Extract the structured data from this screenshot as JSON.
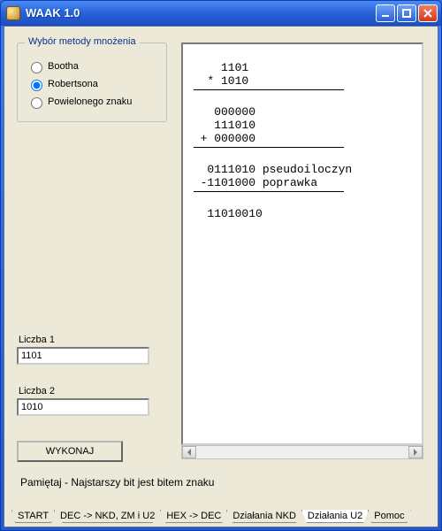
{
  "window": {
    "title": "WAAK 1.0"
  },
  "group": {
    "legend": "Wybór metody mnożenia",
    "options": {
      "booth": "Bootha",
      "robertson": "Robertsona",
      "powielonego": "Powielonego znaku"
    },
    "selected": "robertson"
  },
  "inputs": {
    "label1": "Liczba 1",
    "value1": "1101",
    "label2": "Liczba 2",
    "value2": "1010"
  },
  "buttons": {
    "execute": "WYKONAJ"
  },
  "hint": "Pamiętaj - Najstarszy bit jest bitem znaku",
  "output": {
    "top1": "     1101",
    "top2": "   * 1010",
    "mid1": "    000000",
    "mid2": "    111010",
    "mid3": "  + 000000",
    "s1": "   0111010 pseudoiloczyn",
    "s2": "  -1101000 poprawka",
    "res": "   11010010"
  },
  "tabs": {
    "t0": "START",
    "t1": "DEC -> NKD, ZM i U2",
    "t2": "HEX -> DEC",
    "t3": "Działania NKD",
    "t4": "Działania U2",
    "t5": "Pomoc"
  }
}
